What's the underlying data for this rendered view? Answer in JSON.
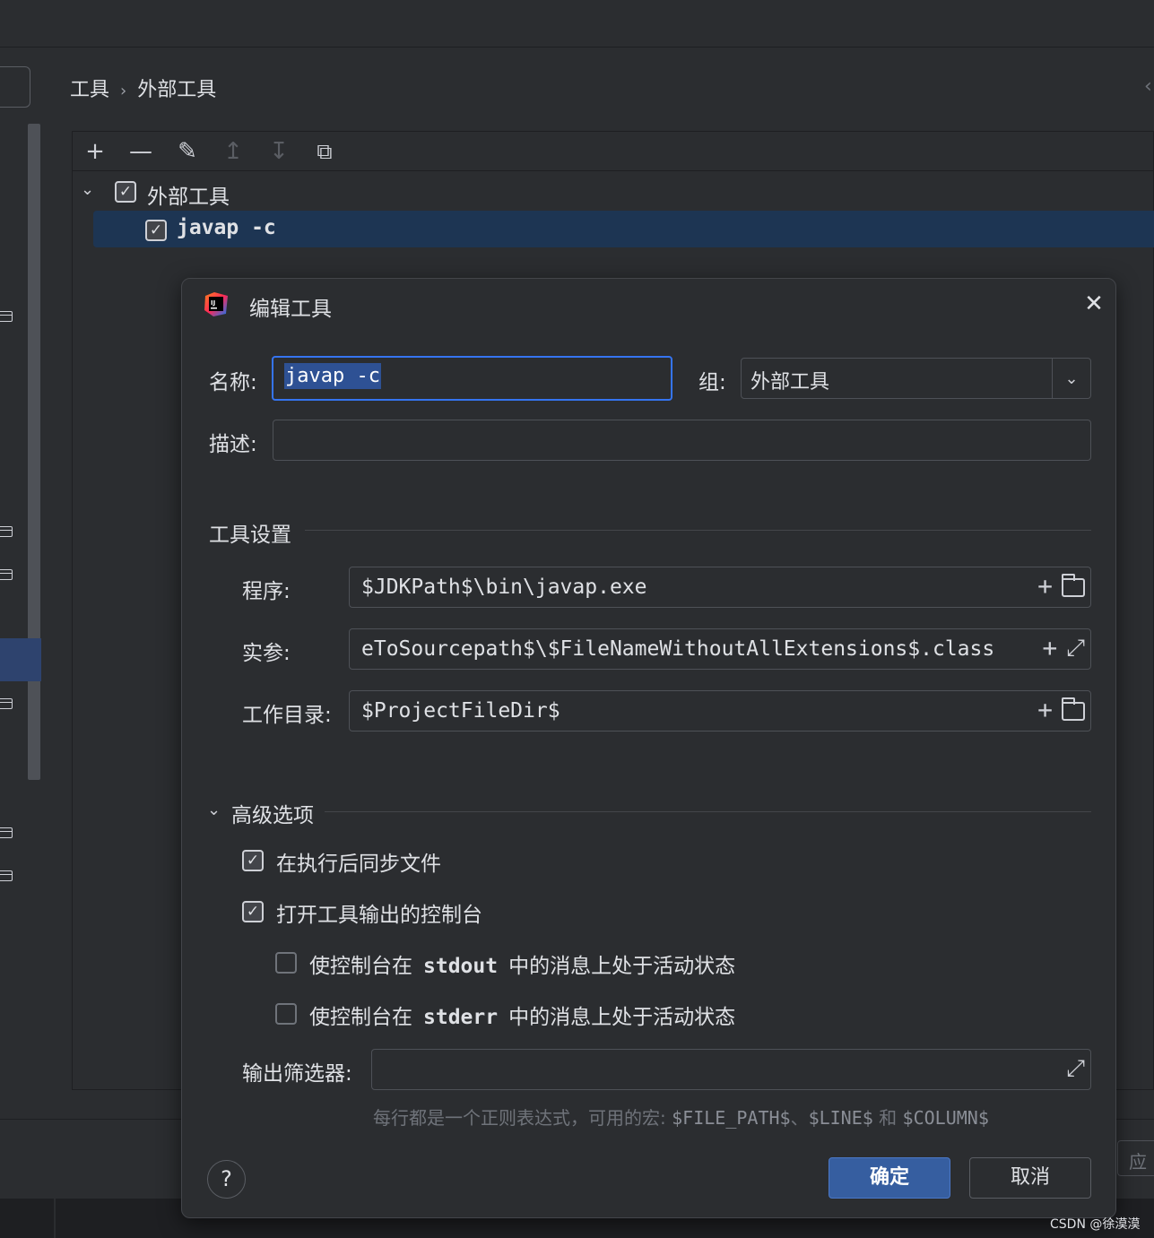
{
  "breadcrumb": {
    "parent": "工具",
    "current": "外部工具"
  },
  "tree": {
    "group_label": "外部工具",
    "tool_label": "javap -c"
  },
  "toolbar": {
    "add": "+",
    "remove": "—",
    "edit": "✎",
    "move_up": "↥",
    "move_down": "↧",
    "copy": "⧉"
  },
  "dialog": {
    "title": "编辑工具",
    "name_label": "名称:",
    "name_value": "javap -c",
    "group_label": "组:",
    "group_value": "外部工具",
    "description_label": "描述:",
    "description_value": "",
    "tool_settings_title": "工具设置",
    "program_label": "程序:",
    "program_value": "$JDKPath$\\bin\\javap.exe",
    "arguments_label": "实参:",
    "arguments_value": "eToSourcepath$\\$FileNameWithoutAllExtensions$.class",
    "working_dir_label": "工作目录:",
    "working_dir_value": "$ProjectFileDir$",
    "advanced_title": "高级选项",
    "sync_files_label": "在执行后同步文件",
    "open_console_label": "打开工具输出的控制台",
    "stdout_prefix": "使控制台在",
    "stdout_code": "stdout",
    "stdout_suffix": "中的消息上处于活动状态",
    "stderr_prefix": "使控制台在",
    "stderr_code": "stderr",
    "stderr_suffix": "中的消息上处于活动状态",
    "output_filter_label": "输出筛选器:",
    "output_filter_value": "",
    "hint_prefix": "每行都是一个正则表达式，可用的宏:",
    "hint_macro1": "$FILE_PATH$",
    "hint_sep": "、",
    "hint_macro2": "$LINE$",
    "hint_and": "和",
    "hint_macro3": "$COLUMN$",
    "help": "?",
    "ok": "确定",
    "cancel": "取消"
  },
  "checkboxes": {
    "group_checked": true,
    "tool_checked": true,
    "sync_files": true,
    "open_console": true,
    "stdout_active": false,
    "stderr_active": false
  },
  "apply_partial": "应",
  "watermark": "CSDN @徐漠漠",
  "colors": {
    "accent": "#3574f0",
    "selection": "#1d3553",
    "background": "#2b2d30"
  },
  "icons": {
    "check": "✓",
    "chevron_down": "⌄",
    "close": "✕",
    "expand": "⤢"
  }
}
